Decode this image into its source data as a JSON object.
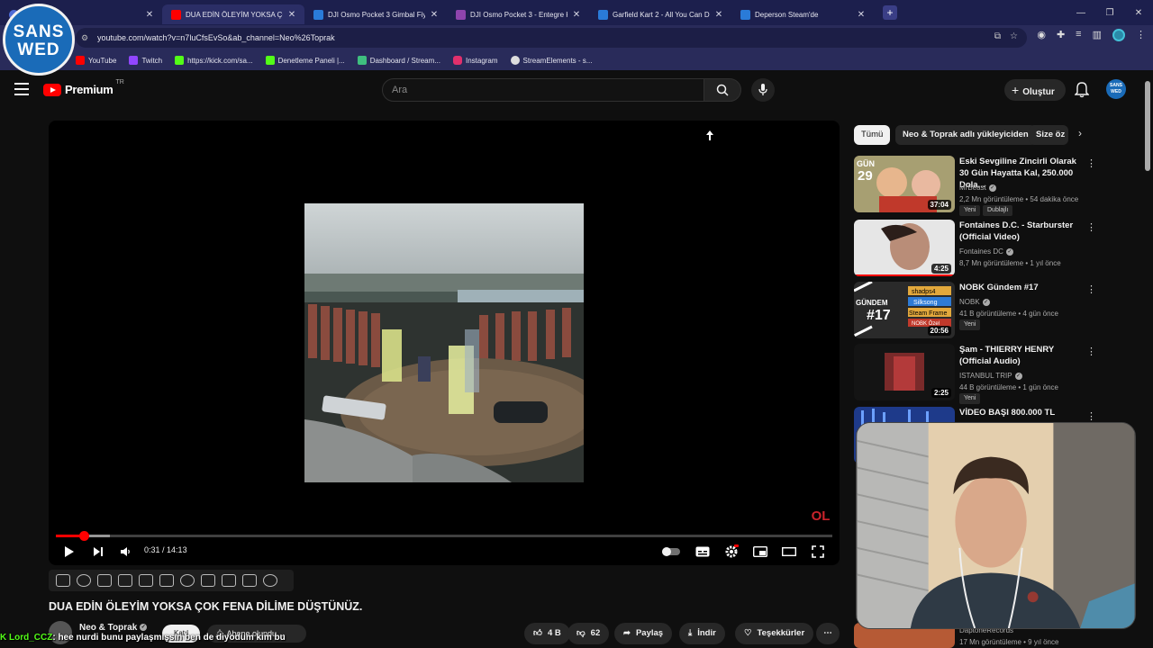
{
  "tabs": [
    {
      "title": "e",
      "favicon_color": "#4d6bd6",
      "active": false
    },
    {
      "title": "DUA EDİN ÖLEYİM YOKSA ÇOK",
      "favicon_color": "#ff0000",
      "active": true
    },
    {
      "title": "DJI Osmo Pocket 3 Gimbal Fiyat",
      "favicon_color": "#2a7bd8",
      "active": false
    },
    {
      "title": "DJI Osmo Pocket 3 - Entegre K",
      "favicon_color": "#8e44ad",
      "active": false
    },
    {
      "title": "Garfield Kart 2 - All You Can D",
      "favicon_color": "#2a7bd8",
      "active": false
    },
    {
      "title": "Deperson Steam'de",
      "favicon_color": "#2a7bd8",
      "active": false
    }
  ],
  "address": "youtube.com/watch?v=n7luCfsEvSo&ab_channel=Neo%26Toprak",
  "bookmarks": [
    {
      "label": "YouTube",
      "color": "#ff0000"
    },
    {
      "label": "Twitch",
      "color": "#9146ff"
    },
    {
      "label": "https://kick.com/sa...",
      "color": "#53fc18"
    },
    {
      "label": "Denetleme Paneli |...",
      "color": "#53fc18"
    },
    {
      "label": "Dashboard / Stream...",
      "color": "#3fbf7f"
    },
    {
      "label": "Instagram",
      "color": "#e1306c"
    },
    {
      "label": "StreamElements - s...",
      "color": "#dddddd"
    }
  ],
  "overlay_logo": {
    "line1": "SANS",
    "line2": "WED"
  },
  "yt": {
    "logo_text": "Premium",
    "logo_region": "TR",
    "search_placeholder": "Ara",
    "create_label": "Oluştur"
  },
  "player": {
    "current_time": "0:31",
    "duration": "14:13",
    "played_fraction": 0.036,
    "buffered_fraction": 0.07,
    "watermark": "OL"
  },
  "video": {
    "title": "DUA EDİN ÖLEYİM YOKSA ÇOK FENA DİLİME DÜŞTÜNÜZ.",
    "channel": "Neo & Toprak",
    "join_label": "Katıl",
    "subscribed_label": "Abone olundu",
    "likes": "4 B",
    "dislikes": "62",
    "share_label": "Paylaş",
    "download_label": "İndir",
    "thanks_label": "Teşekkürler"
  },
  "chat_overlay": {
    "user": "Lord_CCZ",
    "message": "hee nurdi bunu paylaşmışsın ben de diyodum kim bu"
  },
  "chips": [
    "Tümü",
    "Neo & Toprak adlı yükleyiciden",
    "Size öz"
  ],
  "recommendations": [
    {
      "title": "Eski Sevgiline Zincirli Olarak 30 Gün Hayatta Kal, 250.000 Dola...",
      "channel": "MrBeast",
      "verified": true,
      "meta": "2,2 Mn görüntüleme • 54 dakika önce",
      "duration": "37:04",
      "badges": [
        "Yeni",
        "Dublajlı"
      ],
      "thumb_color": "#c9a44a"
    },
    {
      "title": "Fontaines D.C. - Starburster (Official Video)",
      "channel": "Fontaines DC",
      "verified": true,
      "meta": "8,7 Mn görüntüleme • 1 yıl önce",
      "duration": "4:25",
      "badges": [],
      "thumb_color": "#d9d9d9"
    },
    {
      "title": "NOBK Gündem #17",
      "channel": "NOBK",
      "verified": true,
      "meta": "41 B görüntüleme • 4 gün önce",
      "duration": "20:56",
      "badges": [
        "Yeni"
      ],
      "thumb_color": "#2b2b2b"
    },
    {
      "title": "Şam - THIERRY HENRY (Official Audio)",
      "channel": "ISTANBUL TRIP",
      "verified": true,
      "meta": "44 B görüntüleme • 1 gün önce",
      "duration": "2:25",
      "badges": [
        "Yeni"
      ],
      "thumb_color": "#151515"
    },
    {
      "title": "VİDEO BAŞI 800.000 TL",
      "channel": "",
      "verified": false,
      "meta": "",
      "duration": "",
      "badges": [],
      "thumb_color": "#1e3a8a"
    }
  ],
  "partial_rec": {
    "channel": "DaptoneRecords",
    "meta": "17 Mn görüntüleme • 9 yıl önce"
  },
  "nobk_thumb": {
    "big": "GÜNDEM",
    "num": "#17",
    "t1": "shadps4",
    "t2": "Silksong",
    "t3": "Steam Frame",
    "t4": "NOBK Özel"
  },
  "mrbeast_thumb": {
    "gun": "GÜN",
    "num": "29"
  }
}
